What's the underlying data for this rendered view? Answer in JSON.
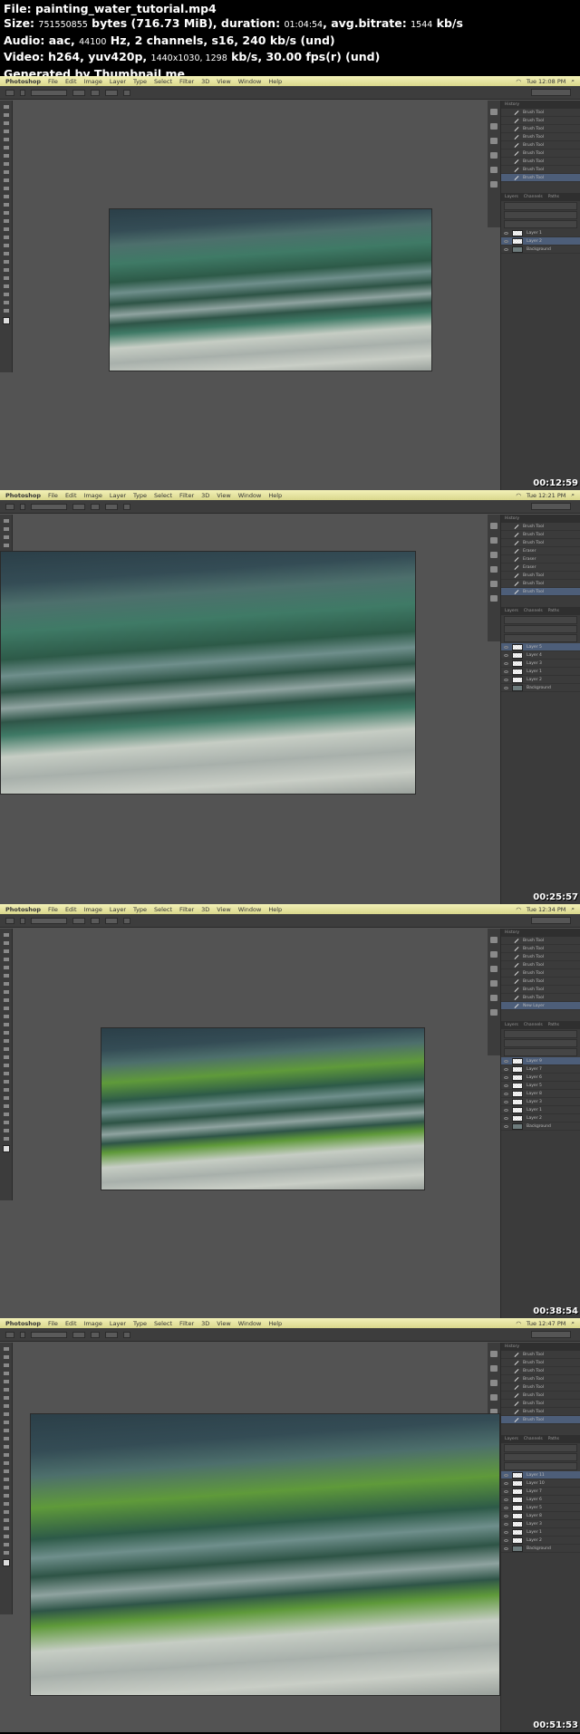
{
  "info": {
    "file_label": "File:",
    "file": "painting_water_tutorial.mp4",
    "size_label": "Size:",
    "size_bytes": "751550855",
    "size_rest": "bytes (716.73 MiB), duration:",
    "duration": "01:04:54",
    "bitrate_label": ", avg.bitrate:",
    "bitrate": "1544",
    "bitrate_unit": "kb/s",
    "audio_label": "Audio: aac,",
    "audio_hz": "44100",
    "audio_rest": "Hz, 2 channels, s16, 240 kb/s (und)",
    "video_label": "Video: h264, yuv420p,",
    "video_res": "1440x1030, 1298",
    "video_rest": "kb/s, 30.00 fps(r) (und)",
    "generated": "Generated by Thumbnail me"
  },
  "menu": [
    "Photoshop",
    "File",
    "Edit",
    "Image",
    "Layer",
    "Type",
    "Select",
    "Filter",
    "3D",
    "View",
    "Window",
    "Help"
  ],
  "panel_tabs": {
    "history": "History",
    "layers": [
      "Layers",
      "Channels",
      "Paths"
    ]
  },
  "frames": [
    {
      "timestamp": "00:12:59",
      "clock": "Tue 12:08 PM",
      "history": [
        "Brush Tool",
        "Brush Tool",
        "Brush Tool",
        "Brush Tool",
        "Brush Tool",
        "Brush Tool",
        "Brush Tool",
        "Brush Tool",
        "Brush Tool"
      ],
      "layers": [
        "Layer 1",
        "Layer 2",
        "Background"
      ],
      "selected_layer": 1
    },
    {
      "timestamp": "00:25:57",
      "clock": "Tue 12:21 PM",
      "history": [
        "Brush Tool",
        "Brush Tool",
        "Brush Tool",
        "Eraser",
        "Eraser",
        "Eraser",
        "Brush Tool",
        "Brush Tool",
        "Brush Tool"
      ],
      "layers": [
        "Layer 5",
        "Layer 4",
        "Layer 3",
        "Layer 1",
        "Layer 2",
        "Background"
      ],
      "selected_layer": 0
    },
    {
      "timestamp": "00:38:54",
      "clock": "Tue 12:34 PM",
      "history": [
        "Brush Tool",
        "Brush Tool",
        "Brush Tool",
        "Brush Tool",
        "Brush Tool",
        "Brush Tool",
        "Brush Tool",
        "Brush Tool",
        "New Layer"
      ],
      "layers": [
        "Layer 9",
        "Layer 7",
        "Layer 6",
        "Layer 5",
        "Layer 8",
        "Layer 3",
        "Layer 1",
        "Layer 2",
        "Background"
      ],
      "selected_layer": 0
    },
    {
      "timestamp": "00:51:53",
      "clock": "Tue 12:47 PM",
      "history": [
        "Brush Tool",
        "Brush Tool",
        "Brush Tool",
        "Brush Tool",
        "Brush Tool",
        "Brush Tool",
        "Brush Tool",
        "Brush Tool",
        "Brush Tool"
      ],
      "layers": [
        "Layer 11",
        "Layer 10",
        "Layer 7",
        "Layer 6",
        "Layer 5",
        "Layer 8",
        "Layer 3",
        "Layer 1",
        "Layer 2",
        "Background"
      ],
      "selected_layer": 0
    }
  ]
}
